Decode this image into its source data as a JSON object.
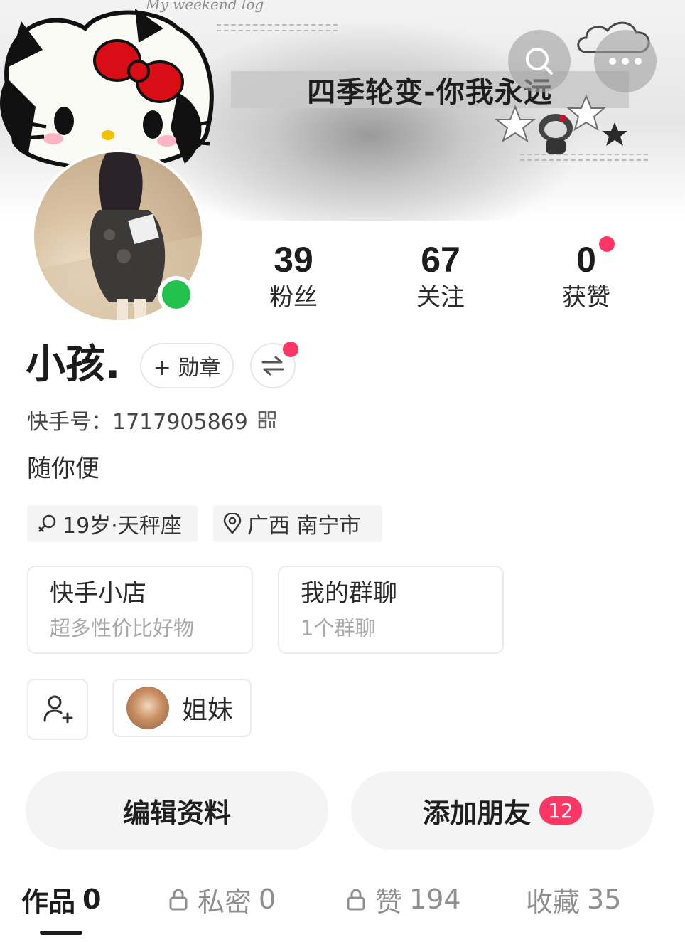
{
  "banner": {
    "script_text": "My weekend log",
    "caption": "四季轮变-你我永远"
  },
  "header": {
    "search_icon": "search-icon",
    "more_icon": "more-icon"
  },
  "stats": {
    "fans": {
      "value": "39",
      "label": "粉丝"
    },
    "following": {
      "value": "67",
      "label": "关注"
    },
    "likes": {
      "value": "0",
      "label": "获赞"
    }
  },
  "profile": {
    "name": "小孩.",
    "medal_button": "+ 勋章",
    "id_label": "快手号：",
    "id_value": "1717905869",
    "bio": "随你便"
  },
  "tags": {
    "age": "19岁·天秤座",
    "location": "广西 南宁市"
  },
  "cards": {
    "shop": {
      "title": "快手小店",
      "subtitle": "超多性价比好物"
    },
    "group": {
      "title": "我的群聊",
      "subtitle": "1个群聊"
    }
  },
  "friends": {
    "sister_label": "姐妹"
  },
  "actions": {
    "edit": "编辑资料",
    "add_friend": "添加朋友",
    "add_friend_badge": "12"
  },
  "tabs": [
    {
      "label": "作品",
      "count": "0"
    },
    {
      "label": "私密",
      "count": "0"
    },
    {
      "label": "赞",
      "count": "194"
    },
    {
      "label": "收藏",
      "count": "35"
    }
  ],
  "colors": {
    "accent": "#fe3666",
    "online": "#23c24f"
  }
}
